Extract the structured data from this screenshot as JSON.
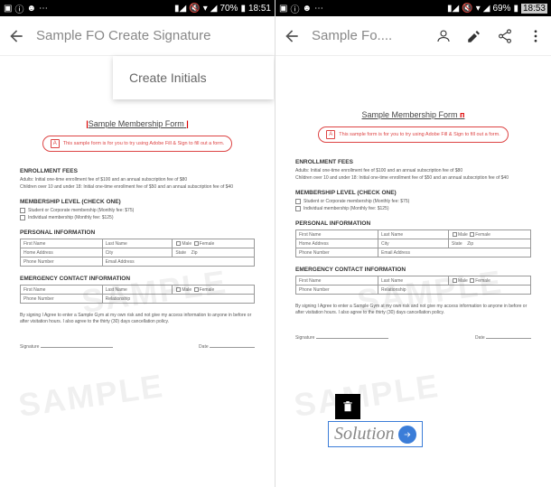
{
  "status": {
    "battery_left": "70%",
    "time_left": "18:51",
    "battery_right": "69%",
    "time_right": "18:53"
  },
  "left": {
    "header_title": "Sample FO Create Signature",
    "menu_item": "Create Initials"
  },
  "right": {
    "header_title": "Sample Fo...."
  },
  "doc": {
    "title": "Sample Membership Form",
    "info": "This sample form is for you to try using Adobe Fill & Sign to fill out a form.",
    "enrollment_title": "ENROLLMENT FEES",
    "enrollment_line1": "Adults: Initial one-time enrollment fee of $100 and an annual subscription fee of $80",
    "enrollment_line2": "Children over 10 and under 18: Initial one-time enrollment fee of $50 and an annual subscription fee of $40",
    "membership_title": "MEMBERSHIP LEVEL (CHECK ONE)",
    "membership_opt1": "Student or Corporate membership (Monthly fee: $75)",
    "membership_opt2": "Individual membership (Monthly fee: $125)",
    "personal_title": "PERSONAL INFORMATION",
    "first_name": "First Name",
    "last_name": "Last Name",
    "male": "Male",
    "female": "Female",
    "home_address": "Home Address",
    "city": "City",
    "state": "State",
    "zip": "Zip",
    "phone": "Phone Number",
    "email": "Email Address",
    "emergency_title": "EMERGENCY CONTACT INFORMATION",
    "relationship": "Relationship",
    "agreement": "By signing I Agree to enter a Sample Gym at my own risk and not give my access information to anyone in before or after visitation hours. I also agree to the thirty (30) days cancellation policy.",
    "signature": "Signature",
    "date": "Date",
    "watermark": "SAMPLE"
  },
  "overlay": {
    "solution_text": "Solution"
  }
}
